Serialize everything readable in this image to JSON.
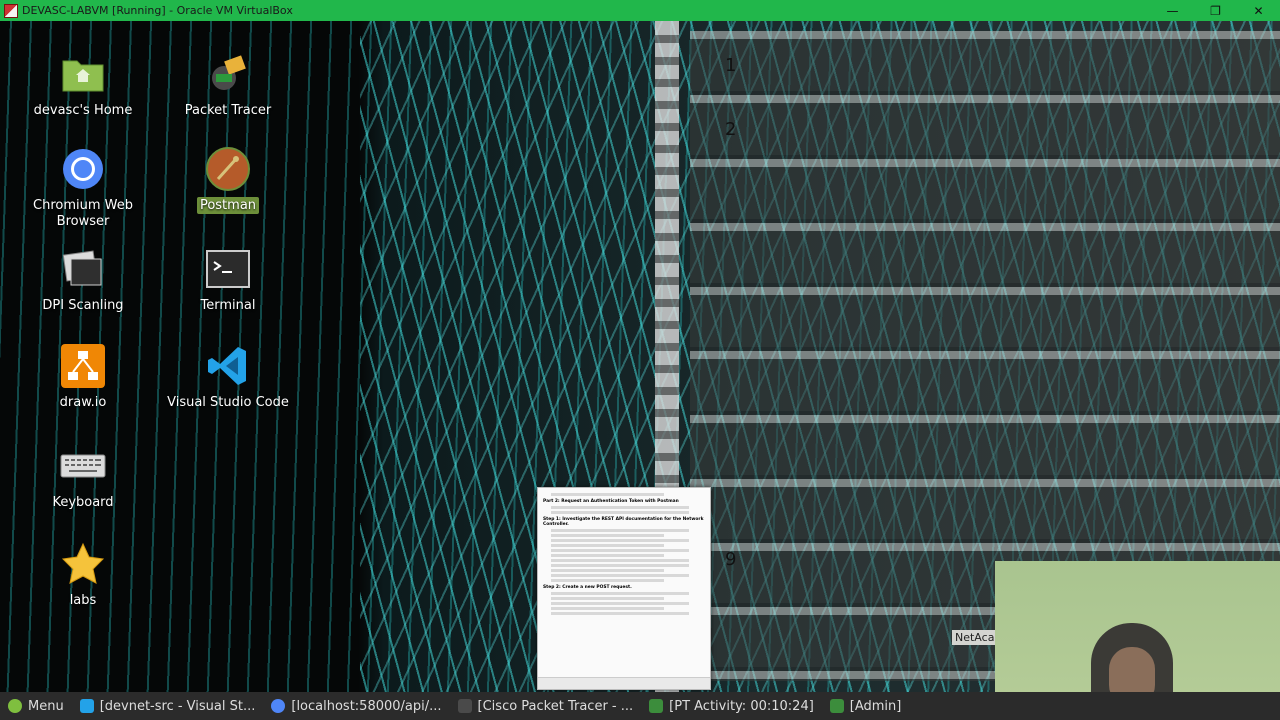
{
  "window": {
    "title": "DEVASC-LABVM [Running] - Oracle VM VirtualBox",
    "minimize": "—",
    "restore": "❐",
    "close": "✕"
  },
  "desktop": {
    "icons": [
      {
        "name": "devasc-home-icon",
        "label": "devasc's Home"
      },
      {
        "name": "packet-tracer-icon",
        "label": "Packet Tracer"
      },
      {
        "name": "chromium-icon",
        "label": "Chromium Web Browser"
      },
      {
        "name": "postman-icon",
        "label": "Postman"
      },
      {
        "name": "dpi-scaling-icon",
        "label": "DPI Scanling"
      },
      {
        "name": "terminal-icon",
        "label": "Terminal"
      },
      {
        "name": "drawio-icon",
        "label": "draw.io"
      },
      {
        "name": "vscode-icon",
        "label": "Visual Studio Code"
      },
      {
        "name": "keyboard-icon",
        "label": "Keyboard"
      },
      {
        "name": "labs-icon",
        "label": "labs"
      }
    ],
    "rack_labels": [
      "1",
      "2",
      "9"
    ],
    "rack_brand": "NetAcad"
  },
  "document": {
    "part_heading": "Part 2: Request an Authentication Token with Postman",
    "step1": "Step 1: Investigate the REST API documentation for the Network Controller.",
    "step2": "Step 2: Create a new POST request."
  },
  "taskbar": {
    "menu": "Menu",
    "items": [
      "[devnet-src - Visual St...",
      "[localhost:58000/api/...",
      "[Cisco Packet Tracer - ...",
      "[PT Activity: 00:10:24]",
      "[Admin]"
    ]
  },
  "colors": {
    "titlebar": "#21b74b",
    "taskbar": "#2b2b2b",
    "cable": "#40d2d2",
    "postman_highlight": "#6d8f3a"
  }
}
